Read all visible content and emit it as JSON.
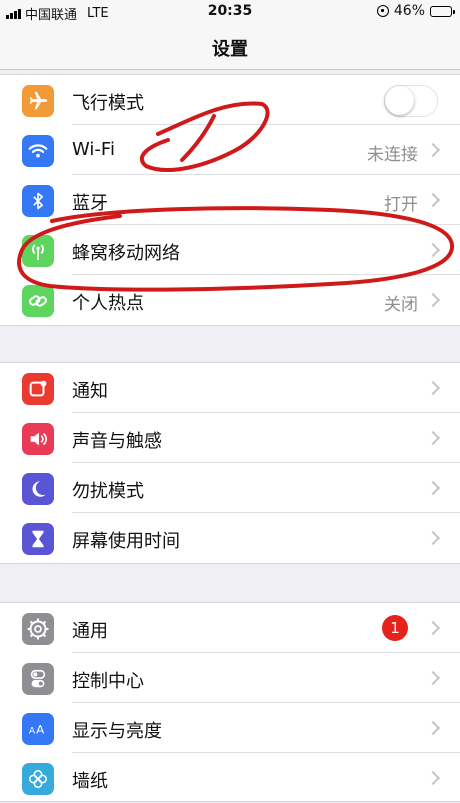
{
  "status_bar": {
    "carrier": "中国联通",
    "network": "LTE",
    "time": "20:35",
    "battery": "46%",
    "battery_level": 0.46
  },
  "nav": {
    "title": "设置"
  },
  "groups": [
    {
      "rows": [
        {
          "label": "飞行模式",
          "value": "",
          "icon": "airplane-icon",
          "icon_color": "#f19a37",
          "control": "toggle",
          "toggle_on": false
        },
        {
          "label": "Wi-Fi",
          "value": "未连接",
          "icon": "wifi-icon",
          "icon_color": "#3478f6"
        },
        {
          "label": "蓝牙",
          "value": "打开",
          "icon": "bluetooth-icon",
          "icon_color": "#3478f6"
        },
        {
          "label": "蜂窝移动网络",
          "value": "",
          "icon": "cellular-antenna-icon",
          "icon_color": "#5dd55f"
        },
        {
          "label": "个人热点",
          "value": "关闭",
          "icon": "hotspot-link-icon",
          "icon_color": "#5dd55f"
        }
      ]
    },
    {
      "rows": [
        {
          "label": "通知",
          "value": "",
          "icon": "notifications-icon",
          "icon_color": "#eb3b30"
        },
        {
          "label": "声音与触感",
          "value": "",
          "icon": "speaker-icon",
          "icon_color": "#ea3a56"
        },
        {
          "label": "勿扰模式",
          "value": "",
          "icon": "moon-icon",
          "icon_color": "#5b55d6"
        },
        {
          "label": "屏幕使用时间",
          "value": "",
          "icon": "hourglass-icon",
          "icon_color": "#5b55d6"
        }
      ]
    },
    {
      "rows": [
        {
          "label": "通用",
          "value": "",
          "icon": "gear-icon",
          "icon_color": "#8e8e93",
          "badge": "1"
        },
        {
          "label": "控制中心",
          "value": "",
          "icon": "toggles-icon",
          "icon_color": "#8e8e93"
        },
        {
          "label": "显示与亮度",
          "value": "",
          "icon": "text-size-icon",
          "icon_color": "#3478f6"
        },
        {
          "label": "墙纸",
          "value": "",
          "icon": "flower-icon",
          "icon_color": "#37aadc"
        }
      ]
    }
  ],
  "colors": {
    "background": "#efeff4",
    "annotation_red": "#d01a1a",
    "badge_red": "#e5231c"
  }
}
